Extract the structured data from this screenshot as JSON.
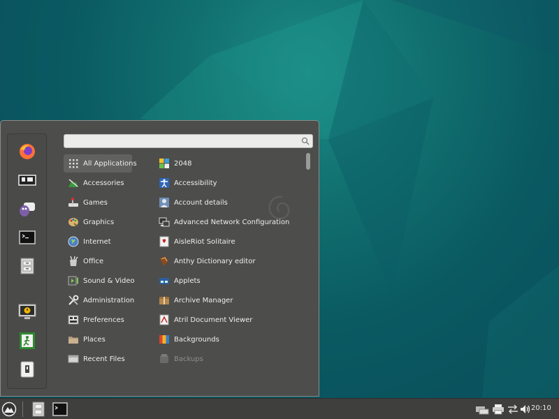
{
  "search": {
    "value": "",
    "placeholder": ""
  },
  "categories": [
    {
      "label": "All Applications",
      "icon": "grid-icon",
      "selected": true
    },
    {
      "label": "Accessories",
      "icon": "accessories-icon"
    },
    {
      "label": "Games",
      "icon": "games-icon"
    },
    {
      "label": "Graphics",
      "icon": "graphics-icon"
    },
    {
      "label": "Internet",
      "icon": "internet-icon"
    },
    {
      "label": "Office",
      "icon": "office-icon"
    },
    {
      "label": "Sound & Video",
      "icon": "sound-video-icon"
    },
    {
      "label": "Administration",
      "icon": "administration-icon"
    },
    {
      "label": "Preferences",
      "icon": "preferences-icon"
    },
    {
      "label": "Places",
      "icon": "folder-icon"
    },
    {
      "label": "Recent Files",
      "icon": "recent-files-icon"
    }
  ],
  "apps": [
    {
      "label": "2048",
      "icon": "game-2048-icon"
    },
    {
      "label": "Accessibility",
      "icon": "accessibility-icon"
    },
    {
      "label": "Account details",
      "icon": "account-icon"
    },
    {
      "label": "Advanced Network Configuration",
      "icon": "network-icon"
    },
    {
      "label": "AisleRiot Solitaire",
      "icon": "cards-icon"
    },
    {
      "label": "Anthy Dictionary editor",
      "icon": "dictionary-icon"
    },
    {
      "label": "Applets",
      "icon": "applets-icon"
    },
    {
      "label": "Archive Manager",
      "icon": "archive-icon"
    },
    {
      "label": "Atril Document Viewer",
      "icon": "document-viewer-icon"
    },
    {
      "label": "Backgrounds",
      "icon": "backgrounds-icon"
    },
    {
      "label": "Backups",
      "icon": "backups-icon",
      "dimmed": true
    }
  ],
  "favorites": [
    "firefox-icon",
    "software-manager-icon",
    "pidgin-icon",
    "terminal-icon",
    "file-cabinet-icon",
    "lock-screen-icon",
    "logout-icon",
    "shutdown-icon"
  ],
  "taskbar": {
    "launchers": [
      "menu-icon",
      "file-manager-icon",
      "terminal-icon"
    ],
    "tray": [
      "network-icon",
      "printer-icon",
      "volume-icon"
    ],
    "clock": "20:10"
  },
  "colors": {
    "menu_bg": "#4d4d4b",
    "selected_bg": "#616160",
    "panel_bg": "#3f3f3e",
    "desktop_teal": "#11706f"
  }
}
